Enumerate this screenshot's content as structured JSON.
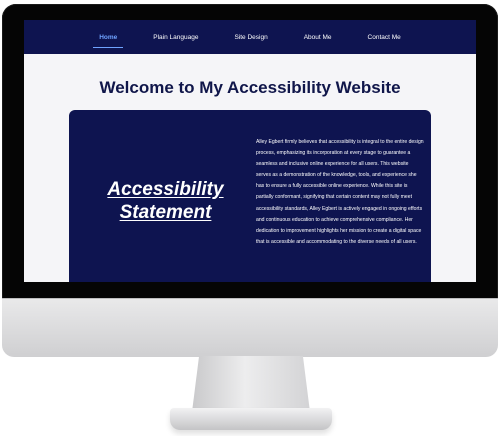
{
  "nav": {
    "items": [
      {
        "label": "Home",
        "active": true
      },
      {
        "label": "Plain Language",
        "active": false
      },
      {
        "label": "Site Design",
        "active": false
      },
      {
        "label": "About Me",
        "active": false
      },
      {
        "label": "Contact Me",
        "active": false
      }
    ]
  },
  "main": {
    "title": "Welcome to My Accessibility Website",
    "statement": {
      "heading": "Accessibility Statement",
      "body": "Alley Egbert firmly believes that accessibility is integral to the entire design process, emphasizing its incorporation at every stage to guarantee a seamless and inclusive online experience for all users. This website serves as a demonstration of the knowledge, tools, and experience she has to ensure a fully accessible online experience. While this site is partially conformant, signifying that certain content may not fully meet accessibility standards, Alley Egbert is actively engaged in ongoing efforts and continuous education to achieve comprehensive compliance. Her dedication to improvement highlights her mission to create a digital space that is accessible and accommodating to the diverse needs of all users."
    }
  },
  "colors": {
    "nav_background": "#0e1450",
    "nav_active": "#6fa3ff",
    "page_background": "#f5f5f8",
    "title_text": "#10164a",
    "card_background": "#0e1450"
  }
}
